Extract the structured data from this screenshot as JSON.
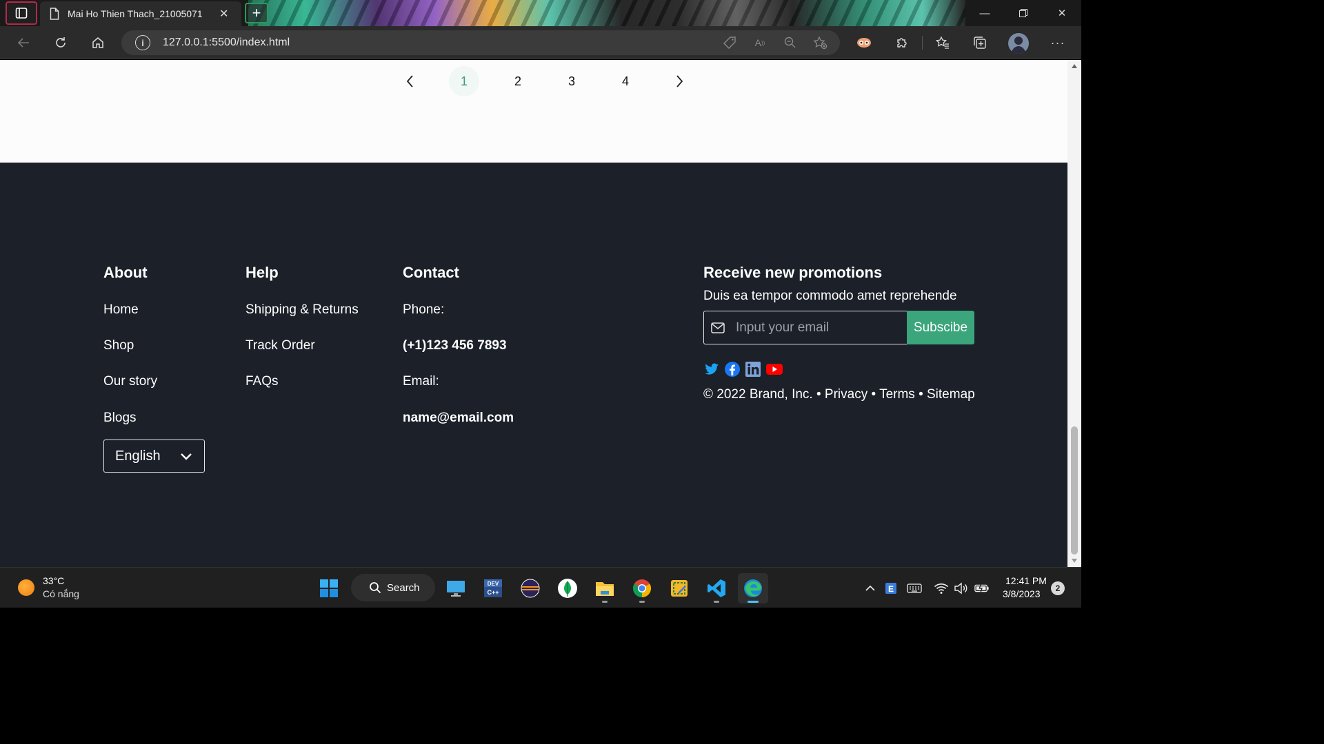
{
  "browser": {
    "tab_title": "Mai Ho Thien Thach_21005071",
    "url": "127.0.0.1:5500/index.html"
  },
  "pagination": {
    "prev_icon": "chevron-left",
    "pages": [
      "1",
      "2",
      "3",
      "4"
    ],
    "active_page": "1",
    "next_icon": "chevron-right",
    "accent_color": "#3a9a7a"
  },
  "footer": {
    "background": "#1b2029",
    "about": {
      "heading": "About",
      "links": [
        "Home",
        "Shop",
        "Our story",
        "Blogs"
      ],
      "language": "English"
    },
    "help": {
      "heading": "Help",
      "links": [
        "Shipping & Returns",
        "Track Order",
        "FAQs"
      ]
    },
    "contact": {
      "heading": "Contact",
      "phone_label": "Phone:",
      "phone_value": "(+1)123 456 7893",
      "email_label": "Email:",
      "email_value": "name@email.com"
    },
    "promo": {
      "heading": "Receive new promotions",
      "subtitle": "Duis ea tempor commodo amet reprehende",
      "email_placeholder": "Input your email",
      "subscribe_label": "Subscibe",
      "button_color": "#3ba57b",
      "socials": [
        "twitter-icon",
        "facebook-icon",
        "linkedin-icon",
        "youtube-icon"
      ],
      "copyright": "© 2022 Brand, Inc. • Privacy • Terms • Sitemap"
    }
  },
  "taskbar": {
    "weather_temp": "33°C",
    "weather_desc": "Có nắng",
    "search_label": "Search",
    "time": "12:41 PM",
    "date": "3/8/2023",
    "notification_count": "2"
  }
}
